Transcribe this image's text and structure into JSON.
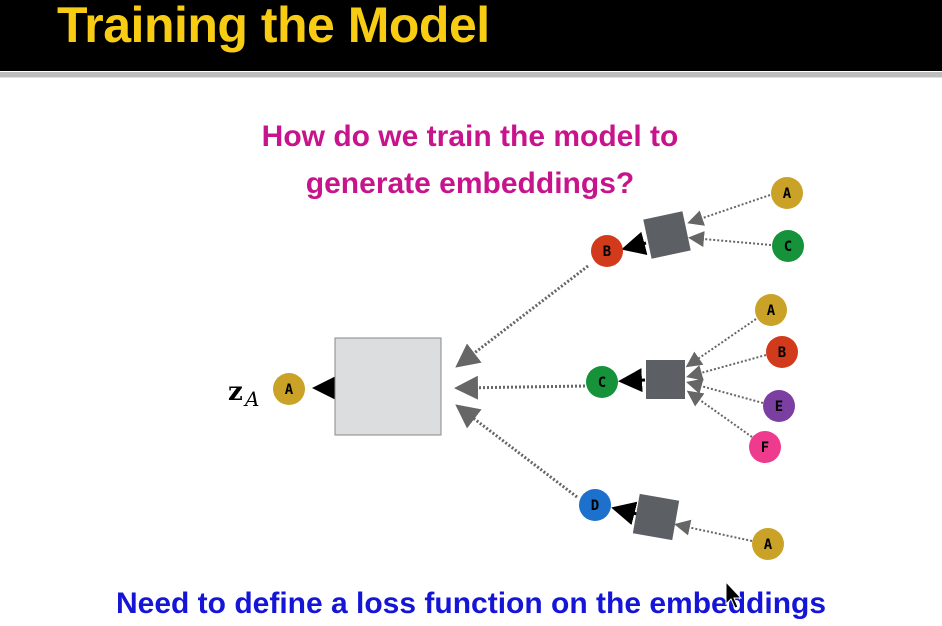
{
  "slide": {
    "title": "Training the Model",
    "question_line1": "How do we train the model to",
    "question_line2": "generate embeddings?",
    "bottom_text": "Need to define a loss function on the embeddings"
  },
  "diagram": {
    "output_label": "z",
    "output_subscript": "A",
    "target": {
      "label": "A",
      "color": "#c9a227"
    },
    "branches": [
      {
        "node": {
          "label": "B",
          "color": "#d23a1c"
        },
        "inputs": [
          {
            "label": "A",
            "color": "#c9a227"
          },
          {
            "label": "C",
            "color": "#16923b"
          }
        ]
      },
      {
        "node": {
          "label": "C",
          "color": "#16923b"
        },
        "inputs": [
          {
            "label": "A",
            "color": "#c9a227"
          },
          {
            "label": "B",
            "color": "#d23a1c"
          },
          {
            "label": "E",
            "color": "#7b3fa1"
          },
          {
            "label": "F",
            "color": "#ee3b8e"
          }
        ]
      },
      {
        "node": {
          "label": "D",
          "color": "#1d70cb"
        },
        "inputs": [
          {
            "label": "A",
            "color": "#c9a227"
          }
        ]
      }
    ]
  },
  "colors": {
    "title": "#f7cc12",
    "question": "#c8148c",
    "bottom": "#1515d8",
    "box": "#dcdddf",
    "aggregator": "#5c5f64"
  }
}
